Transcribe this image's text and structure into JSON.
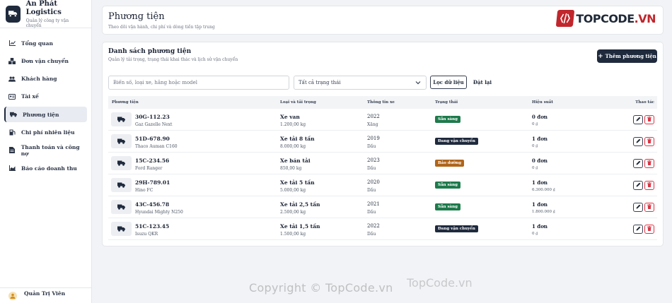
{
  "brand": {
    "name": "An Phát Logistics",
    "subtitle": "Quản lý công ty vận chuyển"
  },
  "nav": [
    {
      "label": "Tổng quan",
      "icon": "chart-line-icon",
      "active": false
    },
    {
      "label": "Đơn vận chuyển",
      "icon": "boxes-icon",
      "active": false
    },
    {
      "label": "Khách hàng",
      "icon": "users-icon",
      "active": false
    },
    {
      "label": "Tài xế",
      "icon": "id-card-icon",
      "active": false
    },
    {
      "label": "Phương tiện",
      "icon": "truck-icon",
      "active": true
    },
    {
      "label": "Chi phí nhiên liệu",
      "icon": "gas-pump-icon",
      "active": false
    },
    {
      "label": "Thanh toán và công nợ",
      "icon": "file-invoice-icon",
      "active": false
    },
    {
      "label": "Báo cáo doanh thu",
      "icon": "chart-area-icon",
      "active": false
    }
  ],
  "user": {
    "name": "Quản Trị Viên"
  },
  "header": {
    "title": "Phương tiện",
    "subtitle": "Theo dõi vận hành, chi phí và dòng tiền tập trung"
  },
  "logo": {
    "prefix": "TOPCODE",
    "suffix": ".VN"
  },
  "list": {
    "title": "Danh sách phương tiện",
    "subtitle": "Quản lý tải trọng, trạng thái khai thác và lịch sử vận chuyển",
    "add_label": "Thêm phương tiện"
  },
  "filters": {
    "search_placeholder": "Biển số, loại xe, hãng hoặc model",
    "status_value": "Tất cả trạng thái",
    "filter_label": "Lọc dữ liệu",
    "reset_label": "Đặt lại"
  },
  "table": {
    "headers": [
      "Phương tiện",
      "Loại và tải trọng",
      "Thông tin xe",
      "Trạng thái",
      "Hiệu suất",
      "Thao tác"
    ],
    "rows": [
      {
        "plate": "30G-112.23",
        "model": "Gaz Gazelle Next",
        "type": "Xe van",
        "load": "1.200,00 kg",
        "year": "2022",
        "fuel": "Xăng",
        "status": "Sẵn sàng",
        "status_color": "#1e7a4c",
        "orders": "0 đơn",
        "revenue": "0 ₫"
      },
      {
        "plate": "51D-678.90",
        "model": "Thaco Auman C160",
        "type": "Xe tải 8 tấn",
        "load": "8.000,00 kg",
        "year": "2019",
        "fuel": "Dầu",
        "status": "Đang vận chuyển",
        "status_color": "#1f2a3d",
        "orders": "1 đơn",
        "revenue": "0 ₫"
      },
      {
        "plate": "15C-234.56",
        "model": "Ford Ranger",
        "type": "Xe bán tải",
        "load": "850,00 kg",
        "year": "2023",
        "fuel": "Dầu",
        "status": "Bảo dưỡng",
        "status_color": "#b0651a",
        "orders": "0 đơn",
        "revenue": "0 ₫"
      },
      {
        "plate": "29H-789.01",
        "model": "Hino FC",
        "type": "Xe tải 5 tấn",
        "load": "5.000,00 kg",
        "year": "2020",
        "fuel": "Dầu",
        "status": "Sẵn sàng",
        "status_color": "#1e7a4c",
        "orders": "1 đơn",
        "revenue": "6.300.000 ₫"
      },
      {
        "plate": "43C-456.78",
        "model": "Hyundai Mighty N250",
        "type": "Xe tải 2,5 tấn",
        "load": "2.500,00 kg",
        "year": "2021",
        "fuel": "Dầu",
        "status": "Sẵn sàng",
        "status_color": "#1e7a4c",
        "orders": "1 đơn",
        "revenue": "1.800.000 ₫"
      },
      {
        "plate": "51C-123.45",
        "model": "Isuzu QKR",
        "type": "Xe tải 1,5 tấn",
        "load": "1.500,00 kg",
        "year": "2022",
        "fuel": "Dầu",
        "status": "Đang vận chuyển",
        "status_color": "#1f2a3d",
        "orders": "1 đơn",
        "revenue": "0 ₫"
      }
    ]
  },
  "watermark": {
    "main": "Copyright © TopCode.vn",
    "secondary": "TopCode.vn"
  }
}
